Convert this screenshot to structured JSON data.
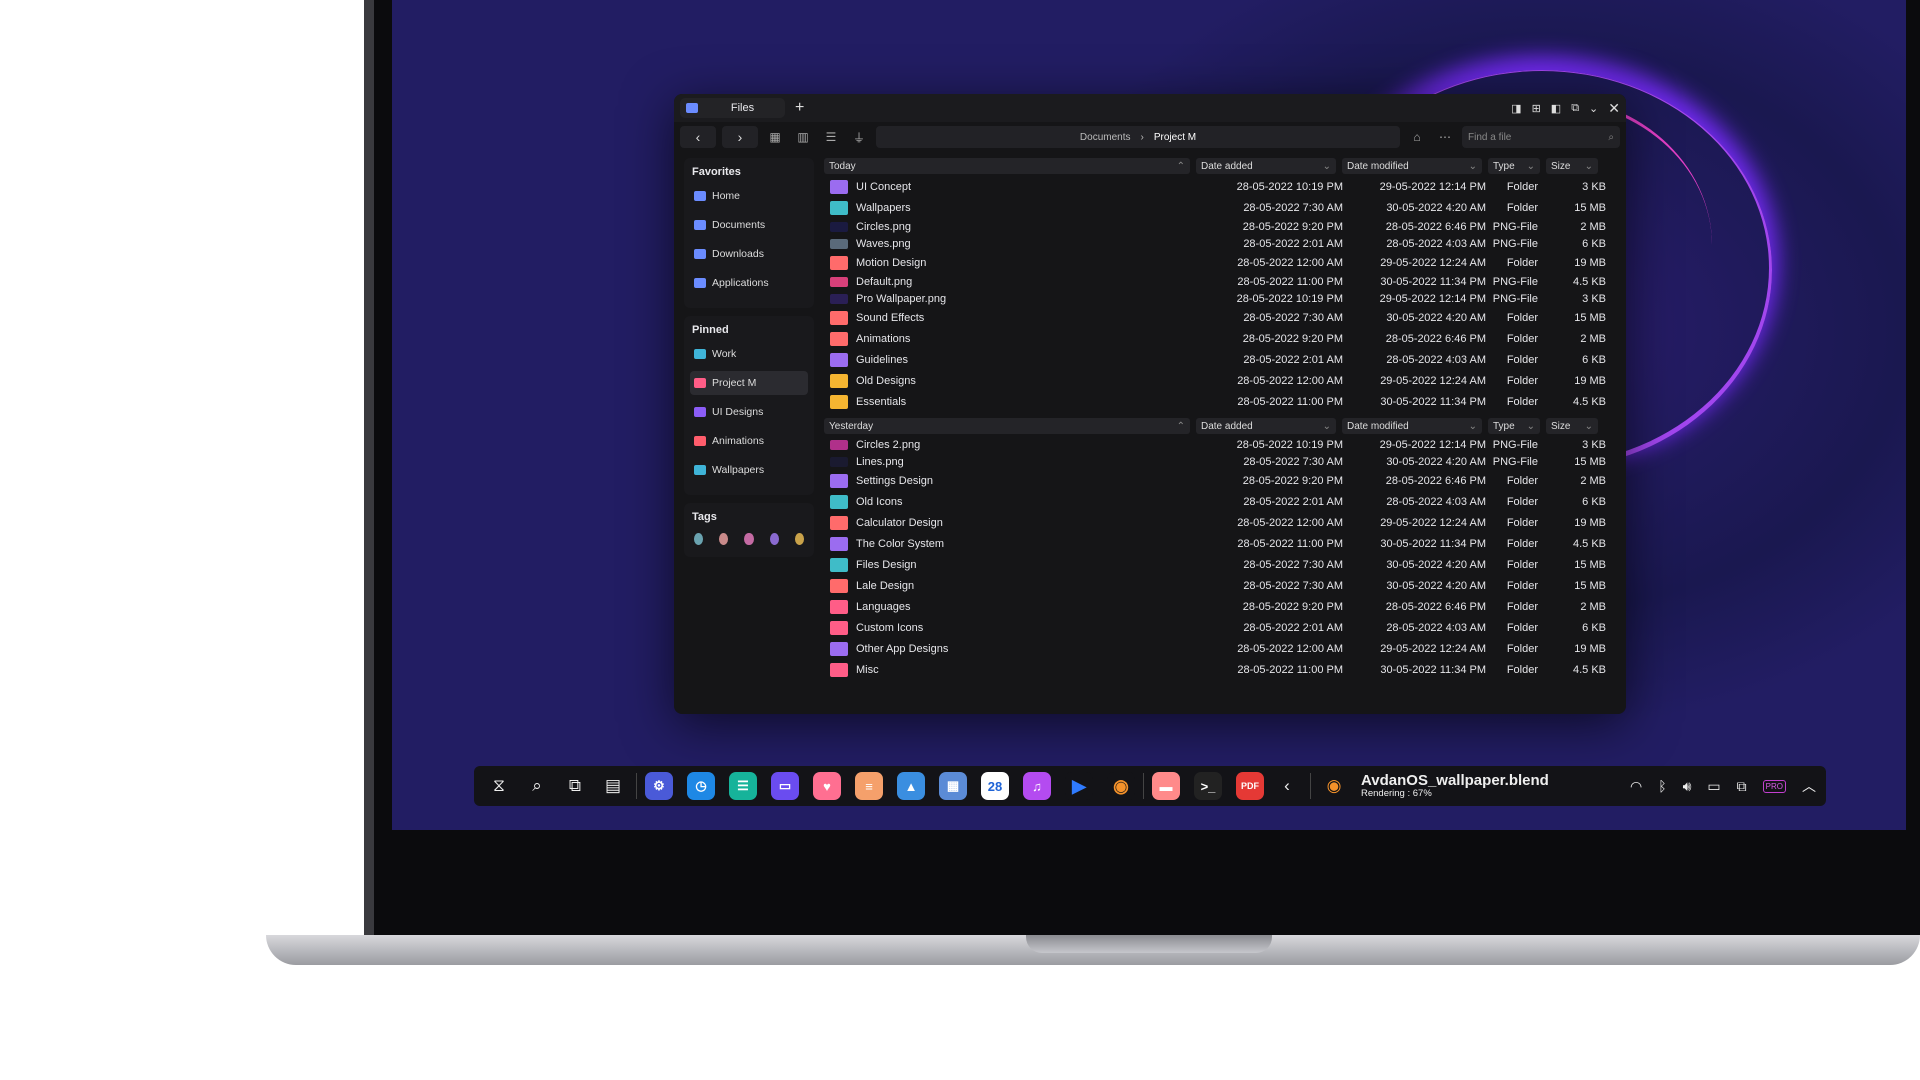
{
  "window": {
    "tab_title": "Files",
    "new_tab": "+",
    "breadcrumb": [
      "Documents",
      "Project M"
    ],
    "search_placeholder": "Find a file"
  },
  "sidebar": {
    "favorites_title": "Favorites",
    "favorites": [
      {
        "label": "Home",
        "color": "#6b8cff"
      },
      {
        "label": "Documents",
        "color": "#6b8cff"
      },
      {
        "label": "Downloads",
        "color": "#6b8cff"
      },
      {
        "label": "Applications",
        "color": "#6b8cff"
      }
    ],
    "pinned_title": "Pinned",
    "pinned": [
      {
        "label": "Work",
        "color": "#3fb4d8"
      },
      {
        "label": "Project M",
        "color": "#ff5d87"
      },
      {
        "label": "UI Designs",
        "color": "#8b5cf6"
      },
      {
        "label": "Animations",
        "color": "#ff5d6c"
      },
      {
        "label": "Wallpapers",
        "color": "#3fb4d8"
      }
    ],
    "tags_title": "Tags",
    "tags": [
      "#6aa3b0",
      "#c98a8a",
      "#c46aa3",
      "#8a6ad0",
      "#c9a24a"
    ]
  },
  "columns": {
    "date_added": "Date added",
    "date_modified": "Date modified",
    "type": "Type",
    "size": "Size"
  },
  "groups": [
    {
      "title": "Today",
      "files": [
        {
          "name": "UI Concept",
          "added": "28-05-2022 10:19 PM",
          "modified": "29-05-2022 12:14 PM",
          "type": "Folder",
          "size": "3 KB",
          "color": "#9b6cf0",
          "kind": "folder"
        },
        {
          "name": "Wallpapers",
          "added": "28-05-2022 7:30 AM",
          "modified": "30-05-2022 4:20 AM",
          "type": "Folder",
          "size": "15 MB",
          "color": "#3fbcc8",
          "kind": "folder"
        },
        {
          "name": "Circles.png",
          "added": "28-05-2022 9:20 PM",
          "modified": "28-05-2022 6:46 PM",
          "type": "PNG-File",
          "size": "2 MB",
          "color": "#1a1a40",
          "kind": "img"
        },
        {
          "name": "Waves.png",
          "added": "28-05-2022 2:01 AM",
          "modified": "28-05-2022 4:03 AM",
          "type": "PNG-File",
          "size": "6 KB",
          "color": "#5a6a7a",
          "kind": "img"
        },
        {
          "name": "Motion Design",
          "added": "28-05-2022 12:00 AM",
          "modified": "29-05-2022 12:24 AM",
          "type": "Folder",
          "size": "19 MB",
          "color": "#ff6b6b",
          "kind": "folder"
        },
        {
          "name": "Default.png",
          "added": "28-05-2022 11:00 PM",
          "modified": "30-05-2022 11:34 PM",
          "type": "PNG-File",
          "size": "4.5 KB",
          "color": "#d8407a",
          "kind": "img"
        },
        {
          "name": "Pro Wallpaper.png",
          "added": "28-05-2022 10:19 PM",
          "modified": "29-05-2022 12:14 PM",
          "type": "PNG-File",
          "size": "3 KB",
          "color": "#2a1f55",
          "kind": "img"
        },
        {
          "name": "Sound Effects",
          "added": "28-05-2022 7:30 AM",
          "modified": "30-05-2022 4:20 AM",
          "type": "Folder",
          "size": "15 MB",
          "color": "#ff6b6b",
          "kind": "folder"
        },
        {
          "name": "Animations",
          "added": "28-05-2022 9:20 PM",
          "modified": "28-05-2022 6:46 PM",
          "type": "Folder",
          "size": "2 MB",
          "color": "#ff6b6b",
          "kind": "folder"
        },
        {
          "name": "Guidelines",
          "added": "28-05-2022 2:01 AM",
          "modified": "28-05-2022 4:03 AM",
          "type": "Folder",
          "size": "6 KB",
          "color": "#9b6cf0",
          "kind": "folder"
        },
        {
          "name": "Old Designs",
          "added": "28-05-2022 12:00 AM",
          "modified": "29-05-2022 12:24 AM",
          "type": "Folder",
          "size": "19 MB",
          "color": "#f5b531",
          "kind": "folder"
        },
        {
          "name": "Essentials",
          "added": "28-05-2022 11:00 PM",
          "modified": "30-05-2022 11:34 PM",
          "type": "Folder",
          "size": "4.5 KB",
          "color": "#f5b531",
          "kind": "folder"
        }
      ]
    },
    {
      "title": "Yesterday",
      "files": [
        {
          "name": "Circles 2.png",
          "added": "28-05-2022 10:19 PM",
          "modified": "29-05-2022 12:14 PM",
          "type": "PNG-File",
          "size": "3 KB",
          "color": "#b0308a",
          "kind": "img"
        },
        {
          "name": "Lines.png",
          "added": "28-05-2022 7:30 AM",
          "modified": "30-05-2022 4:20 AM",
          "type": "PNG-File",
          "size": "15 MB",
          "color": "#1a1a30",
          "kind": "img"
        },
        {
          "name": "Settings Design",
          "added": "28-05-2022 9:20 PM",
          "modified": "28-05-2022 6:46 PM",
          "type": "Folder",
          "size": "2 MB",
          "color": "#9b6cf0",
          "kind": "folder"
        },
        {
          "name": "Old Icons",
          "added": "28-05-2022 2:01 AM",
          "modified": "28-05-2022 4:03 AM",
          "type": "Folder",
          "size": "6 KB",
          "color": "#3fbcc8",
          "kind": "folder"
        },
        {
          "name": "Calculator Design",
          "added": "28-05-2022 12:00 AM",
          "modified": "29-05-2022 12:24 AM",
          "type": "Folder",
          "size": "19 MB",
          "color": "#ff6b6b",
          "kind": "folder"
        },
        {
          "name": "The Color System",
          "added": "28-05-2022 11:00 PM",
          "modified": "30-05-2022 11:34 PM",
          "type": "Folder",
          "size": "4.5 KB",
          "color": "#9b6cf0",
          "kind": "folder"
        },
        {
          "name": "Files Design",
          "added": "28-05-2022 7:30 AM",
          "modified": "30-05-2022 4:20 AM",
          "type": "Folder",
          "size": "15 MB",
          "color": "#3fbcc8",
          "kind": "folder"
        },
        {
          "name": "Lale Design",
          "added": "28-05-2022 7:30 AM",
          "modified": "30-05-2022 4:20 AM",
          "type": "Folder",
          "size": "15 MB",
          "color": "#ff6b6b",
          "kind": "folder"
        },
        {
          "name": "Languages",
          "added": "28-05-2022 9:20 PM",
          "modified": "28-05-2022 6:46 PM",
          "type": "Folder",
          "size": "2 MB",
          "color": "#ff5d87",
          "kind": "folder"
        },
        {
          "name": "Custom Icons",
          "added": "28-05-2022 2:01 AM",
          "modified": "28-05-2022 4:03 AM",
          "type": "Folder",
          "size": "6 KB",
          "color": "#ff5d87",
          "kind": "folder"
        },
        {
          "name": "Other App Designs",
          "added": "28-05-2022 12:00 AM",
          "modified": "29-05-2022 12:24 AM",
          "type": "Folder",
          "size": "19 MB",
          "color": "#9b6cf0",
          "kind": "folder"
        },
        {
          "name": "Misc",
          "added": "28-05-2022 11:00 PM",
          "modified": "30-05-2022 11:34 PM",
          "type": "Folder",
          "size": "4.5 KB",
          "color": "#ff5d87",
          "kind": "folder"
        }
      ]
    }
  ],
  "taskbar": {
    "apps": [
      {
        "name": "settings-app",
        "color": "#4a5ad8",
        "glyph": "⚙"
      },
      {
        "name": "clock-app",
        "color": "#1e88e5",
        "glyph": "◷"
      },
      {
        "name": "messages-app",
        "color": "#16b39a",
        "glyph": "☰"
      },
      {
        "name": "window-app",
        "color": "#6a4cf0",
        "glyph": "▭"
      },
      {
        "name": "brush-app",
        "color": "#ff6f91",
        "glyph": "♥"
      },
      {
        "name": "notes-app",
        "color": "#f5a06b",
        "glyph": "≡"
      },
      {
        "name": "photos-app",
        "color": "#3a8ee0",
        "glyph": "▲"
      },
      {
        "name": "calculator-app",
        "color": "#5b8bd6",
        "glyph": "▦"
      },
      {
        "name": "calendar-app",
        "color": "#ffffff",
        "glyph": "28"
      },
      {
        "name": "music-app",
        "color": "#b44bf0",
        "glyph": "♫"
      },
      {
        "name": "player-app",
        "color": "#131317",
        "glyph": "▶"
      },
      {
        "name": "blender-app",
        "color": "#131317",
        "glyph": "◉"
      }
    ],
    "pinned": [
      {
        "name": "files-app",
        "color": "#ff8a8a",
        "glyph": "▬"
      },
      {
        "name": "terminal-app",
        "color": "#222",
        "glyph": ">_"
      },
      {
        "name": "pdf-app",
        "color": "#e53935",
        "glyph": "PDF"
      }
    ],
    "render_file": "AvdanOS_wallpaper.blend",
    "render_status": "Rendering : 67%",
    "render_progress": 0.67,
    "pro_badge": "PRO"
  }
}
